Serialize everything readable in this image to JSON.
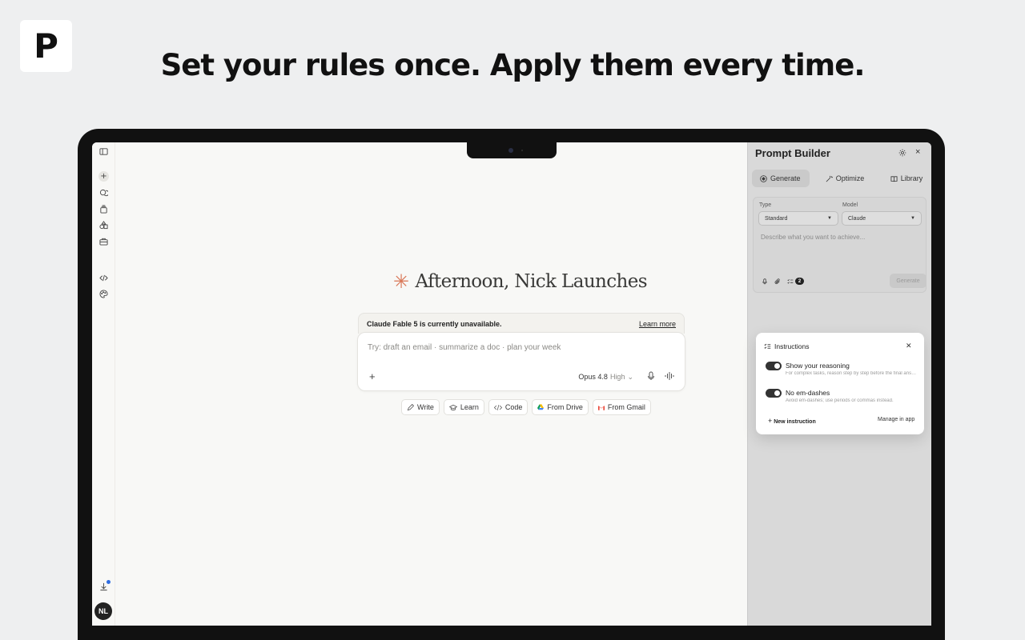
{
  "brand": {
    "logo_letter": "P"
  },
  "headline": "Set your rules once. Apply them every time.",
  "sidebar": {
    "icons": [
      "sidebar-toggle-icon",
      "new-chat-icon",
      "chats-icon",
      "projects-icon",
      "artifacts-icon",
      "toolbox-icon",
      "code-icon",
      "palette-icon",
      "download-icon"
    ],
    "avatar_initials": "NL"
  },
  "main": {
    "greeting": "Afternoon, Nick Launches",
    "notice": {
      "message": "Claude Fable 5 is currently unavailable.",
      "link": "Learn more"
    },
    "composer": {
      "placeholder": "Try: draft an email · summarize a doc · plan your week",
      "model": "Opus 4.8",
      "effort": "High"
    },
    "chips": [
      {
        "label": "Write",
        "icon": "pencil-icon"
      },
      {
        "label": "Learn",
        "icon": "graduation-cap-icon"
      },
      {
        "label": "Code",
        "icon": "code-icon"
      },
      {
        "label": "From Drive",
        "icon": "google-drive-icon"
      },
      {
        "label": "From Gmail",
        "icon": "gmail-icon"
      }
    ]
  },
  "panel": {
    "title": "Prompt Builder",
    "tabs": [
      {
        "label": "Generate",
        "active": true
      },
      {
        "label": "Optimize",
        "active": false
      },
      {
        "label": "Library",
        "active": false
      }
    ],
    "form": {
      "type_label": "Type",
      "type_value": "Standard",
      "model_label": "Model",
      "model_value": "Claude",
      "description_placeholder": "Describe what you want to achieve...",
      "instruction_count": "2",
      "generate_label": "Generate"
    },
    "instructions": {
      "title": "Instructions",
      "rules": [
        {
          "title": "Show your reasoning",
          "description": "For complex tasks, reason step by step before the final answer.",
          "enabled": true
        },
        {
          "title": "No em-dashes",
          "description": "Avoid em-dashes; use periods or commas instead.",
          "enabled": true
        }
      ],
      "new_label": "New instruction",
      "manage_label": "Manage in app"
    }
  },
  "colors": {
    "accent_star": "#d97757",
    "panel_bg": "#d9d9d9",
    "page_bg": "#eeeff0"
  }
}
